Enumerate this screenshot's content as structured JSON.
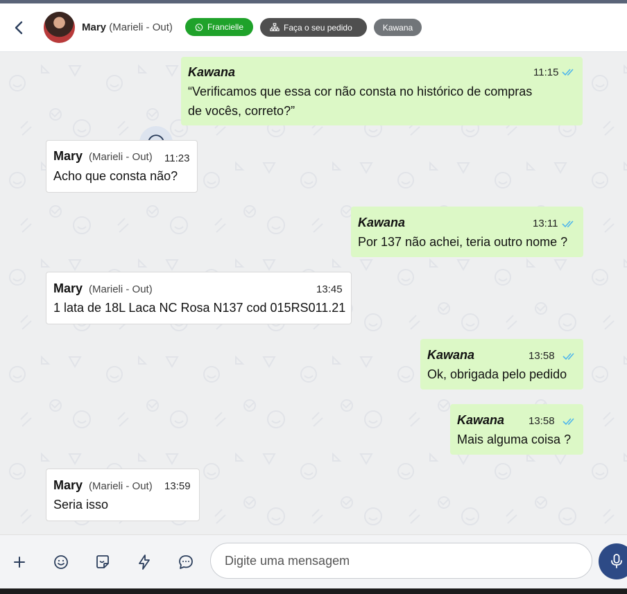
{
  "header": {
    "contact_name": "Mary",
    "contact_sub": "(Marieli - Out)",
    "tags": {
      "whatsapp": "Francielle",
      "order": "Faça o seu pedido",
      "agent": "Kawana"
    }
  },
  "messages": [
    {
      "direction": "out",
      "sender": "Kawana",
      "time": "11:15",
      "lines": [
        "“Verificamos que essa cor não consta no histórico de compras",
        "de vocês, correto?”"
      ]
    },
    {
      "direction": "in",
      "sender": "Mary",
      "sender_sub": "(Marieli - Out)",
      "time": "11:23",
      "lines": [
        "Acho que consta não?"
      ]
    },
    {
      "direction": "out",
      "sender": "Kawana",
      "time": "13:11",
      "lines": [
        "Por 137 não achei, teria outro nome ?"
      ]
    },
    {
      "direction": "in",
      "sender": "Mary",
      "sender_sub": "(Marieli - Out)",
      "time": "13:45",
      "lines": [
        "1 lata de 18L Laca NC Rosa N137 cod 015RS011.21"
      ]
    },
    {
      "direction": "out",
      "sender": "Kawana",
      "time": "13:58",
      "lines": [
        "Ok, obrigada pelo pedido"
      ]
    },
    {
      "direction": "out",
      "sender": "Kawana",
      "time": "13:58",
      "lines": [
        "Mais alguma coisa ?"
      ]
    },
    {
      "direction": "in",
      "sender": "Mary",
      "sender_sub": "(Marieli - Out)",
      "time": "13:59",
      "lines": [
        "Seria isso"
      ]
    }
  ],
  "composer": {
    "placeholder": "Digite uma mensagem",
    "tools": [
      "plus-icon",
      "emoji-icon",
      "sticker-icon",
      "lightning-icon",
      "chat-bubble-icon"
    ]
  },
  "colors": {
    "outgoing_bubble": "#dcf8c6",
    "incoming_bubble": "#ffffff",
    "whatsapp_tag": "#1fa22a",
    "mic_button": "#2d4a86",
    "read_ticks": "#4fb6ec"
  }
}
